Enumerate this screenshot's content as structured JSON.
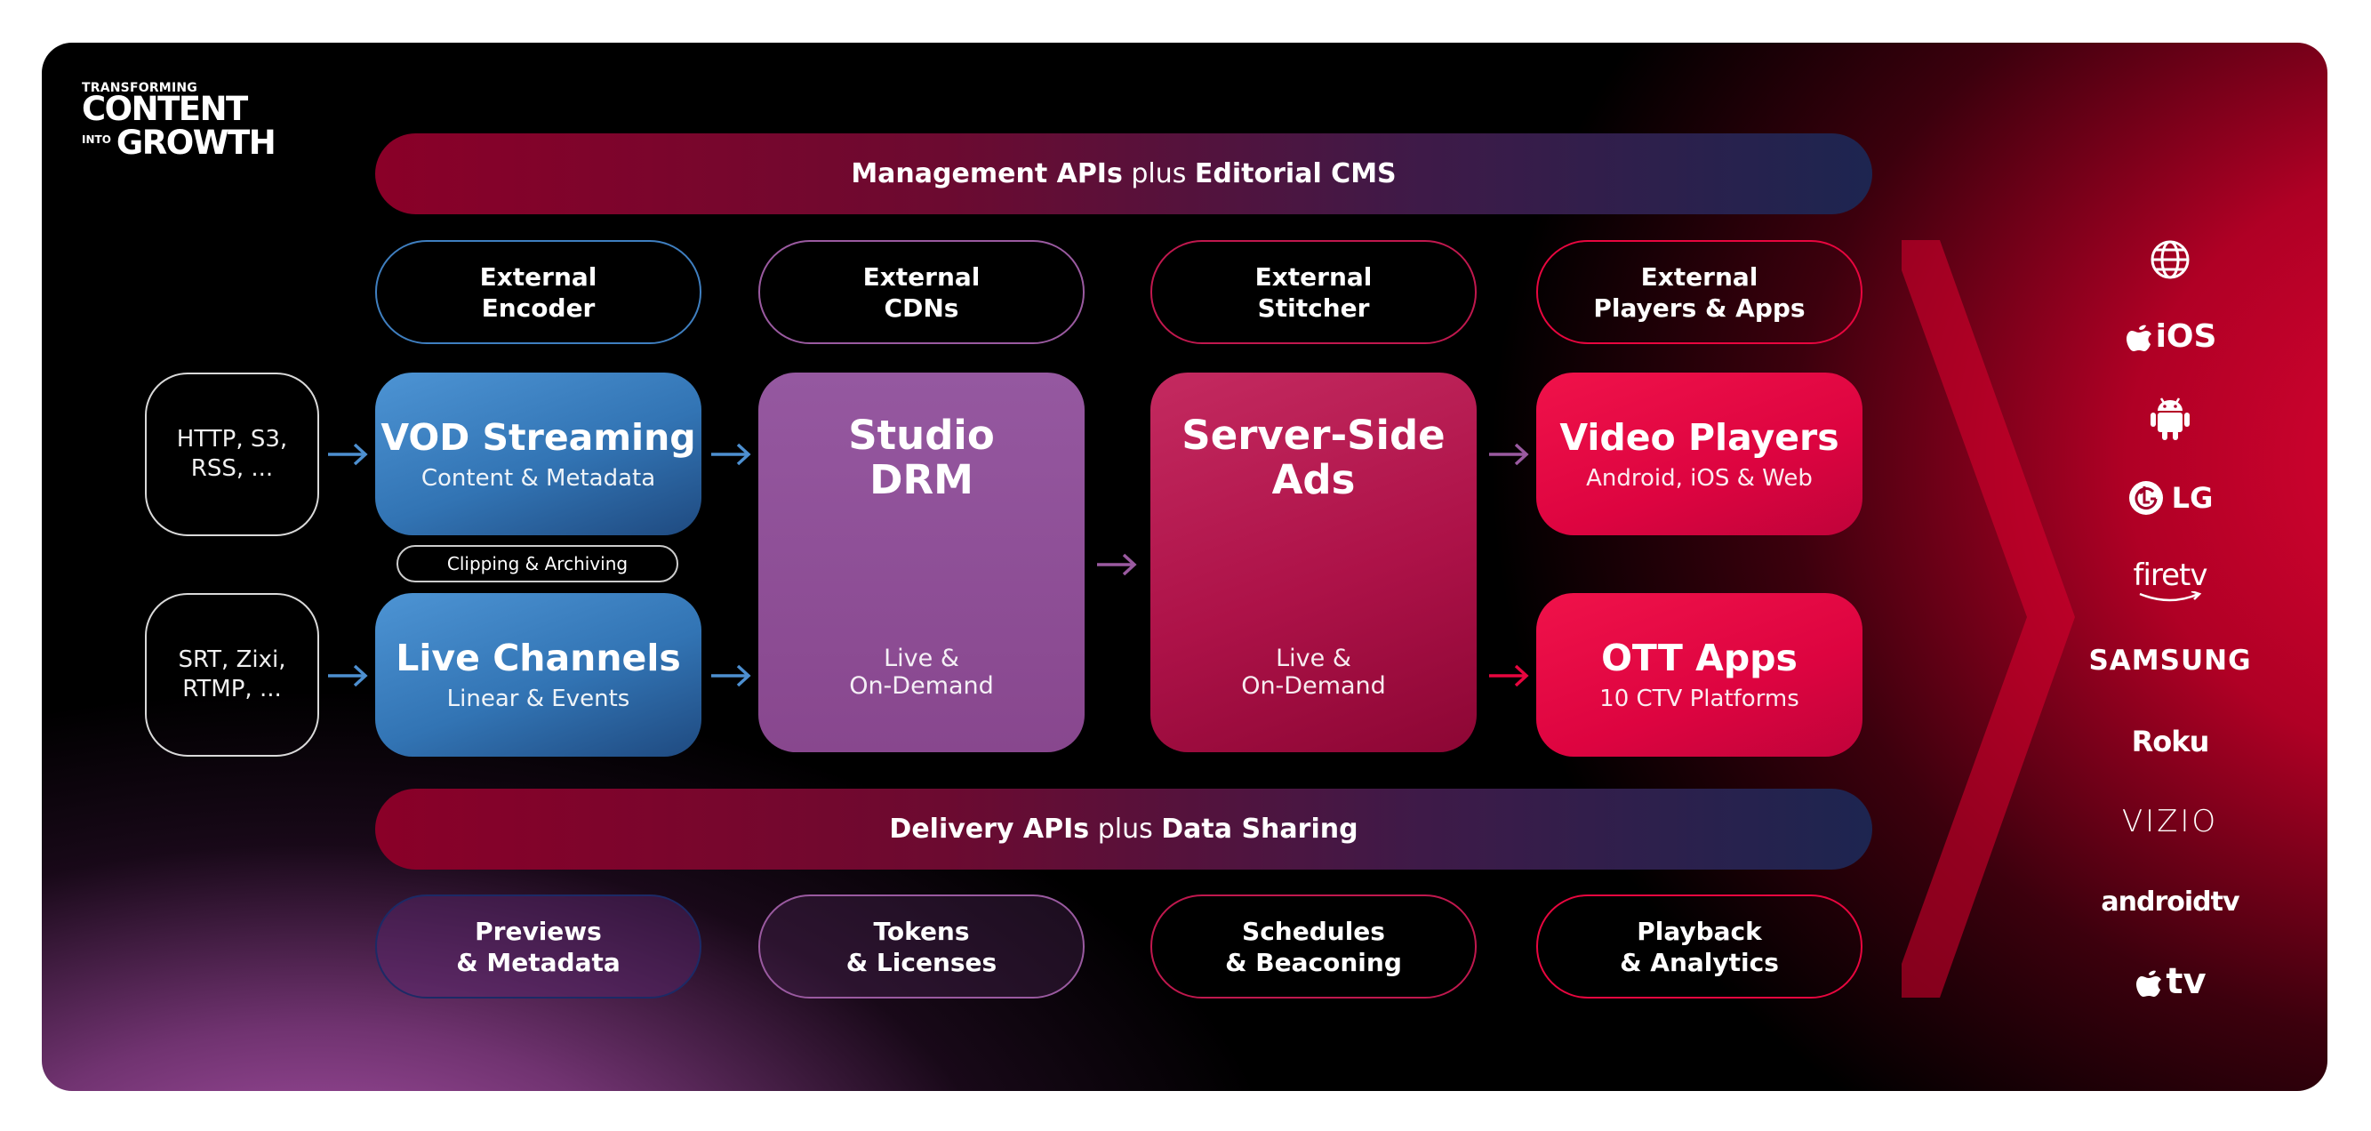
{
  "logo": {
    "line1": "TRANSFORMING",
    "line2": "CONTENT",
    "into": "INTO",
    "line3": "GROWTH"
  },
  "bars": {
    "top": {
      "bold1": "Management APIs",
      "plus": " plus ",
      "bold2": "Editorial CMS"
    },
    "bottom": {
      "bold1": "Delivery APIs",
      "plus": " plus ",
      "bold2": "Data Sharing"
    }
  },
  "external": [
    {
      "line1": "External",
      "line2": "Encoder"
    },
    {
      "line1": "External",
      "line2": "CDNs"
    },
    {
      "line1": "External",
      "line2": "Stitcher"
    },
    {
      "line1": "External",
      "line2": "Players & Apps"
    }
  ],
  "sources": [
    {
      "line1": "HTTP, S3,",
      "line2": "RSS, ..."
    },
    {
      "line1": "SRT, Zixi,",
      "line2": "RTMP, ..."
    }
  ],
  "vod": {
    "title": "VOD Streaming",
    "subtitle": "Content & Metadata"
  },
  "clipping": "Clipping & Archiving",
  "live": {
    "title": "Live Channels",
    "subtitle": "Linear & Events"
  },
  "drm": {
    "title1": "Studio",
    "title2": "DRM",
    "sub1": "Live &",
    "sub2": "On-Demand"
  },
  "ads": {
    "title1": "Server-Side",
    "title2": "Ads",
    "sub1": "Live &",
    "sub2": "On-Demand"
  },
  "players": {
    "title": "Video Players",
    "subtitle": "Android, iOS & Web"
  },
  "ott": {
    "title": "OTT Apps",
    "subtitle": "10 CTV Platforms"
  },
  "bottom_pills": [
    {
      "line1": "Previews",
      "line2": "& Metadata"
    },
    {
      "line1": "Tokens",
      "line2": "& Licenses"
    },
    {
      "line1": "Schedules",
      "line2": "& Beaconing"
    },
    {
      "line1": "Playback",
      "line2": "& Analytics"
    }
  ],
  "platforms": {
    "ios": "iOS",
    "lg": "LG",
    "firetv": "firetv",
    "samsung": "SAMSUNG",
    "roku": "Roku",
    "vizio": "VIZIO",
    "androidtv": "androidtv",
    "appletv": "tv"
  },
  "colors": {
    "blue_box": "#3d86c6",
    "purple_box": "#8e4e94",
    "ads_box": "#b3184e",
    "red_box": "#e8063f",
    "arrow_blue": "#4d8fd0",
    "arrow_purple": "#9a5aa0",
    "arrow_red": "#e8063f"
  }
}
